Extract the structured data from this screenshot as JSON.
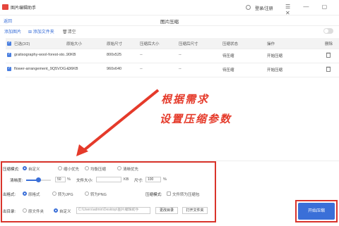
{
  "app": {
    "title": "图片编辑助手",
    "login": "登录/注册",
    "back": "返回",
    "page_title": "图片压缩"
  },
  "toolbar": {
    "add_image": "添加图片",
    "add_folder": "添加文件夹",
    "clear": "清空"
  },
  "table": {
    "headers": [
      "已选(2/2)",
      "原始大小",
      "原始尺寸",
      "压缩后大小",
      "压缩后尺寸",
      "压缩状态",
      "操作",
      "删除"
    ],
    "rows": [
      {
        "name": "gratisography-wool-forest-sto...",
        "size": "90KB",
        "dims": "800x525",
        "csize": "--",
        "cdims": "--",
        "status": "待压缩",
        "action": "开始压缩"
      },
      {
        "name": "flower-arrangement_9Q5VOG...",
        "size": "436KB",
        "dims": "960x640",
        "csize": "--",
        "cdims": "--",
        "status": "待压缩",
        "action": "开始压缩"
      }
    ]
  },
  "annotation": {
    "line1": "根据需求",
    "line2": "设置压缩参数"
  },
  "settings": {
    "mode_label": "压缩模式:",
    "modes": [
      "自定义",
      "缩小优先",
      "均衡压缩",
      "清晰优先"
    ],
    "clarity_label": "清晰度:",
    "clarity_value": "50",
    "clarity_unit": "%",
    "filesize_label": "文件大小:",
    "filesize_unit": "KB",
    "dims_label": "尺寸:",
    "dims_value": "100",
    "dims_unit": "%",
    "output_format_label": "出格式:",
    "formats": [
      "原格式",
      "转为JPG",
      "转为PNG"
    ],
    "compress_mode_label": "压缩模式:",
    "compress_mode_option": "文件转为压缩包",
    "output_dir_label": "出目录:",
    "dirs": [
      "原文件夹",
      "自定义"
    ],
    "dir_path": "C:\\Users\\admin\\Desktop\\图片编辑助手",
    "change_dir": "更改目录",
    "open_folder": "打开文件夹",
    "start": "开始压缩",
    "clarity_level": 0.5
  },
  "colors": {
    "accent": "#3a6fd8",
    "annotation": "#e53a2a"
  }
}
